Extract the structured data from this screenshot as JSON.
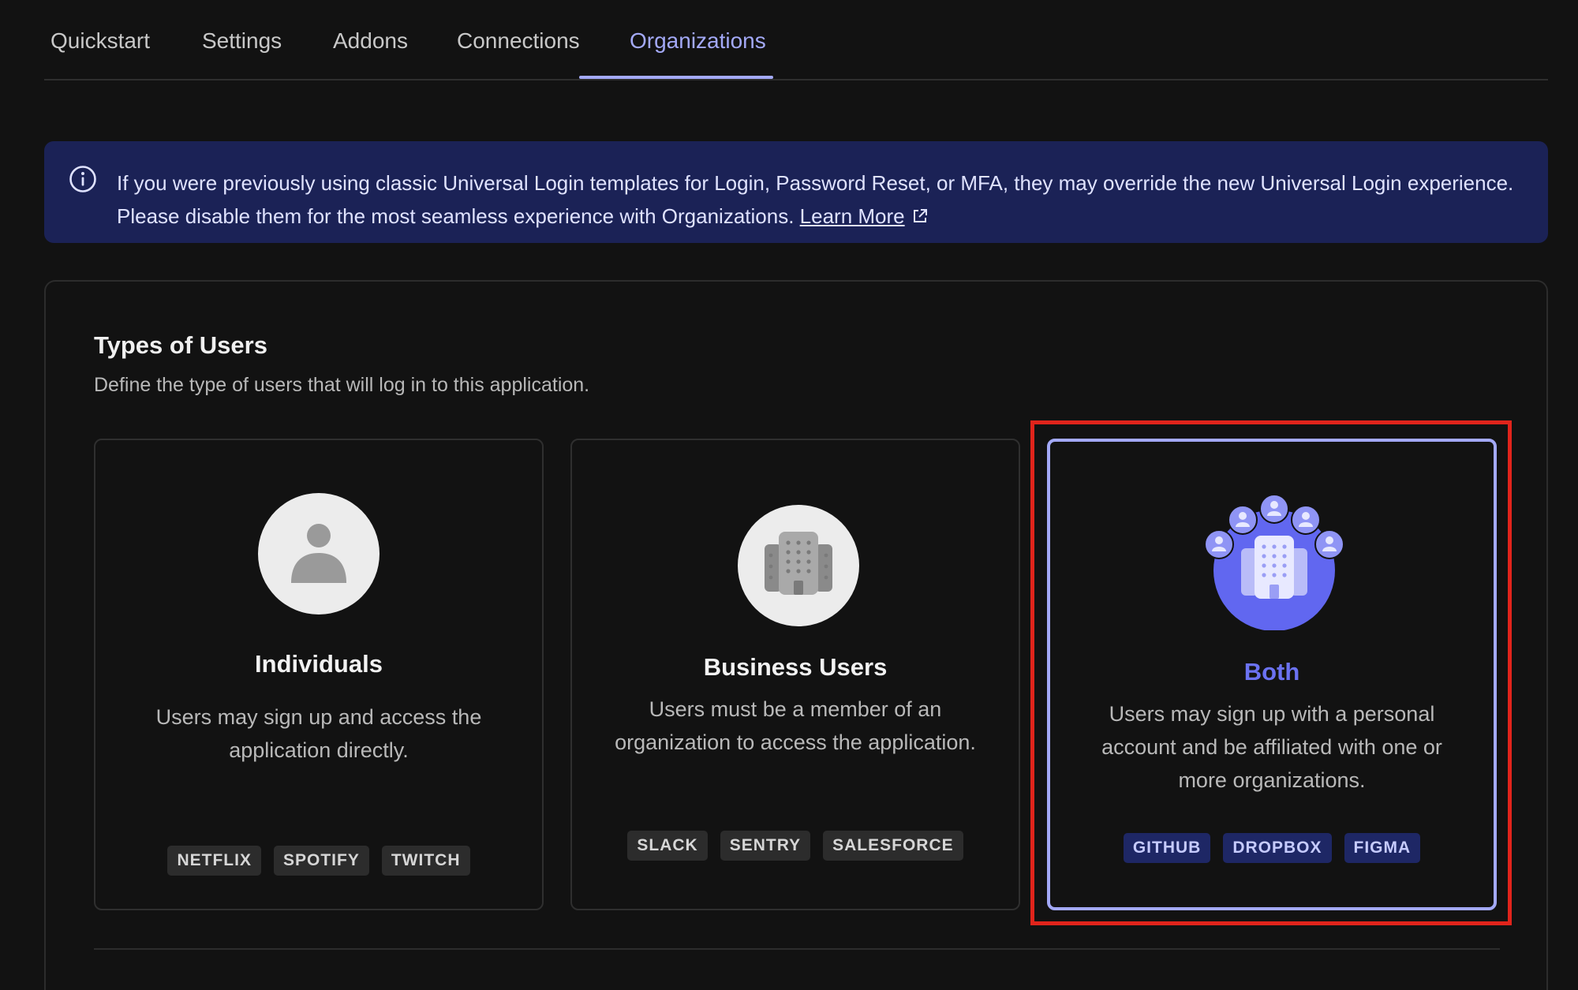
{
  "tabs": [
    {
      "label": "Quickstart"
    },
    {
      "label": "Settings"
    },
    {
      "label": "Addons"
    },
    {
      "label": "Connections"
    },
    {
      "label": "Organizations"
    }
  ],
  "active_tab": "Organizations",
  "banner": {
    "icon": "info-icon",
    "text": "If you were previously using classic Universal Login templates for Login, Password Reset, or MFA, they may override the new Universal Login experience. Please disable them for the most seamless experience with Organizations.",
    "link_label": "Learn More",
    "link_icon": "external-link-icon"
  },
  "section": {
    "title": "Types of Users",
    "subtitle": "Define the type of users that will log in to this application."
  },
  "options": [
    {
      "icon": "person-icon",
      "title": "Individuals",
      "description": "Users may sign up and access the application directly.",
      "badges": [
        "NETFLIX",
        "SPOTIFY",
        "TWITCH"
      ],
      "selected": false
    },
    {
      "icon": "building-icon",
      "title": "Business Users",
      "description": "Users must be a member of an organization to access the application.",
      "badges": [
        "SLACK",
        "SENTRY",
        "SALESFORCE"
      ],
      "selected": false
    },
    {
      "icon": "building-with-users-icon",
      "title": "Both",
      "description": "Users may sign up with a personal account and be affiliated with one or more organizations.",
      "badges": [
        "GITHUB",
        "DROPBOX",
        "FIGMA"
      ],
      "selected": true
    }
  ],
  "colors": {
    "accent": "#a3a9f7",
    "selected_title": "#6b72f2",
    "banner_bg": "#1b2256",
    "highlight": "#e0241b"
  }
}
